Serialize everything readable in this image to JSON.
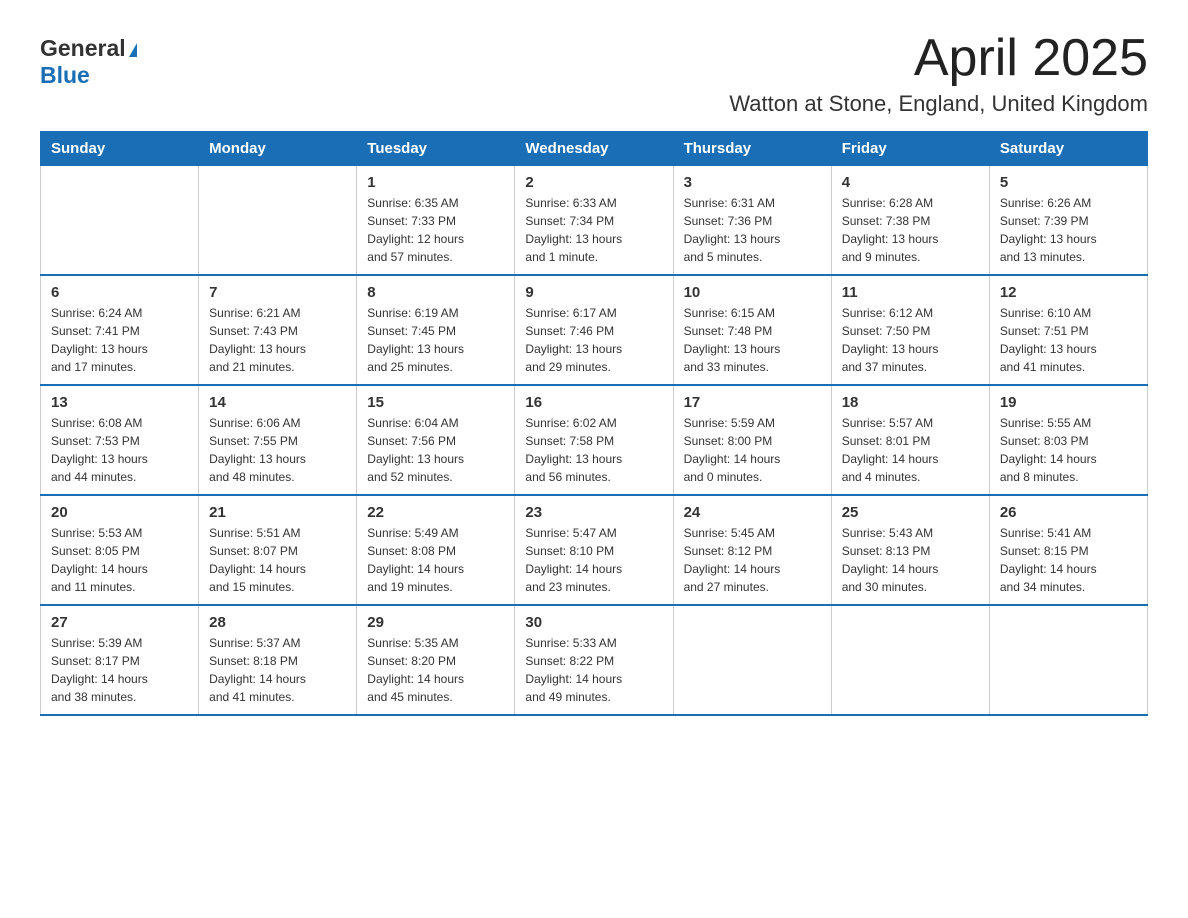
{
  "logo": {
    "general": "General",
    "blue": "Blue",
    "aria": "GeneralBlue logo"
  },
  "title": {
    "month": "April 2025",
    "location": "Watton at Stone, England, United Kingdom"
  },
  "days_of_week": [
    "Sunday",
    "Monday",
    "Tuesday",
    "Wednesday",
    "Thursday",
    "Friday",
    "Saturday"
  ],
  "weeks": [
    [
      {
        "day": "",
        "info": ""
      },
      {
        "day": "",
        "info": ""
      },
      {
        "day": "1",
        "info": "Sunrise: 6:35 AM\nSunset: 7:33 PM\nDaylight: 12 hours\nand 57 minutes."
      },
      {
        "day": "2",
        "info": "Sunrise: 6:33 AM\nSunset: 7:34 PM\nDaylight: 13 hours\nand 1 minute."
      },
      {
        "day": "3",
        "info": "Sunrise: 6:31 AM\nSunset: 7:36 PM\nDaylight: 13 hours\nand 5 minutes."
      },
      {
        "day": "4",
        "info": "Sunrise: 6:28 AM\nSunset: 7:38 PM\nDaylight: 13 hours\nand 9 minutes."
      },
      {
        "day": "5",
        "info": "Sunrise: 6:26 AM\nSunset: 7:39 PM\nDaylight: 13 hours\nand 13 minutes."
      }
    ],
    [
      {
        "day": "6",
        "info": "Sunrise: 6:24 AM\nSunset: 7:41 PM\nDaylight: 13 hours\nand 17 minutes."
      },
      {
        "day": "7",
        "info": "Sunrise: 6:21 AM\nSunset: 7:43 PM\nDaylight: 13 hours\nand 21 minutes."
      },
      {
        "day": "8",
        "info": "Sunrise: 6:19 AM\nSunset: 7:45 PM\nDaylight: 13 hours\nand 25 minutes."
      },
      {
        "day": "9",
        "info": "Sunrise: 6:17 AM\nSunset: 7:46 PM\nDaylight: 13 hours\nand 29 minutes."
      },
      {
        "day": "10",
        "info": "Sunrise: 6:15 AM\nSunset: 7:48 PM\nDaylight: 13 hours\nand 33 minutes."
      },
      {
        "day": "11",
        "info": "Sunrise: 6:12 AM\nSunset: 7:50 PM\nDaylight: 13 hours\nand 37 minutes."
      },
      {
        "day": "12",
        "info": "Sunrise: 6:10 AM\nSunset: 7:51 PM\nDaylight: 13 hours\nand 41 minutes."
      }
    ],
    [
      {
        "day": "13",
        "info": "Sunrise: 6:08 AM\nSunset: 7:53 PM\nDaylight: 13 hours\nand 44 minutes."
      },
      {
        "day": "14",
        "info": "Sunrise: 6:06 AM\nSunset: 7:55 PM\nDaylight: 13 hours\nand 48 minutes."
      },
      {
        "day": "15",
        "info": "Sunrise: 6:04 AM\nSunset: 7:56 PM\nDaylight: 13 hours\nand 52 minutes."
      },
      {
        "day": "16",
        "info": "Sunrise: 6:02 AM\nSunset: 7:58 PM\nDaylight: 13 hours\nand 56 minutes."
      },
      {
        "day": "17",
        "info": "Sunrise: 5:59 AM\nSunset: 8:00 PM\nDaylight: 14 hours\nand 0 minutes."
      },
      {
        "day": "18",
        "info": "Sunrise: 5:57 AM\nSunset: 8:01 PM\nDaylight: 14 hours\nand 4 minutes."
      },
      {
        "day": "19",
        "info": "Sunrise: 5:55 AM\nSunset: 8:03 PM\nDaylight: 14 hours\nand 8 minutes."
      }
    ],
    [
      {
        "day": "20",
        "info": "Sunrise: 5:53 AM\nSunset: 8:05 PM\nDaylight: 14 hours\nand 11 minutes."
      },
      {
        "day": "21",
        "info": "Sunrise: 5:51 AM\nSunset: 8:07 PM\nDaylight: 14 hours\nand 15 minutes."
      },
      {
        "day": "22",
        "info": "Sunrise: 5:49 AM\nSunset: 8:08 PM\nDaylight: 14 hours\nand 19 minutes."
      },
      {
        "day": "23",
        "info": "Sunrise: 5:47 AM\nSunset: 8:10 PM\nDaylight: 14 hours\nand 23 minutes."
      },
      {
        "day": "24",
        "info": "Sunrise: 5:45 AM\nSunset: 8:12 PM\nDaylight: 14 hours\nand 27 minutes."
      },
      {
        "day": "25",
        "info": "Sunrise: 5:43 AM\nSunset: 8:13 PM\nDaylight: 14 hours\nand 30 minutes."
      },
      {
        "day": "26",
        "info": "Sunrise: 5:41 AM\nSunset: 8:15 PM\nDaylight: 14 hours\nand 34 minutes."
      }
    ],
    [
      {
        "day": "27",
        "info": "Sunrise: 5:39 AM\nSunset: 8:17 PM\nDaylight: 14 hours\nand 38 minutes."
      },
      {
        "day": "28",
        "info": "Sunrise: 5:37 AM\nSunset: 8:18 PM\nDaylight: 14 hours\nand 41 minutes."
      },
      {
        "day": "29",
        "info": "Sunrise: 5:35 AM\nSunset: 8:20 PM\nDaylight: 14 hours\nand 45 minutes."
      },
      {
        "day": "30",
        "info": "Sunrise: 5:33 AM\nSunset: 8:22 PM\nDaylight: 14 hours\nand 49 minutes."
      },
      {
        "day": "",
        "info": ""
      },
      {
        "day": "",
        "info": ""
      },
      {
        "day": "",
        "info": ""
      }
    ]
  ]
}
